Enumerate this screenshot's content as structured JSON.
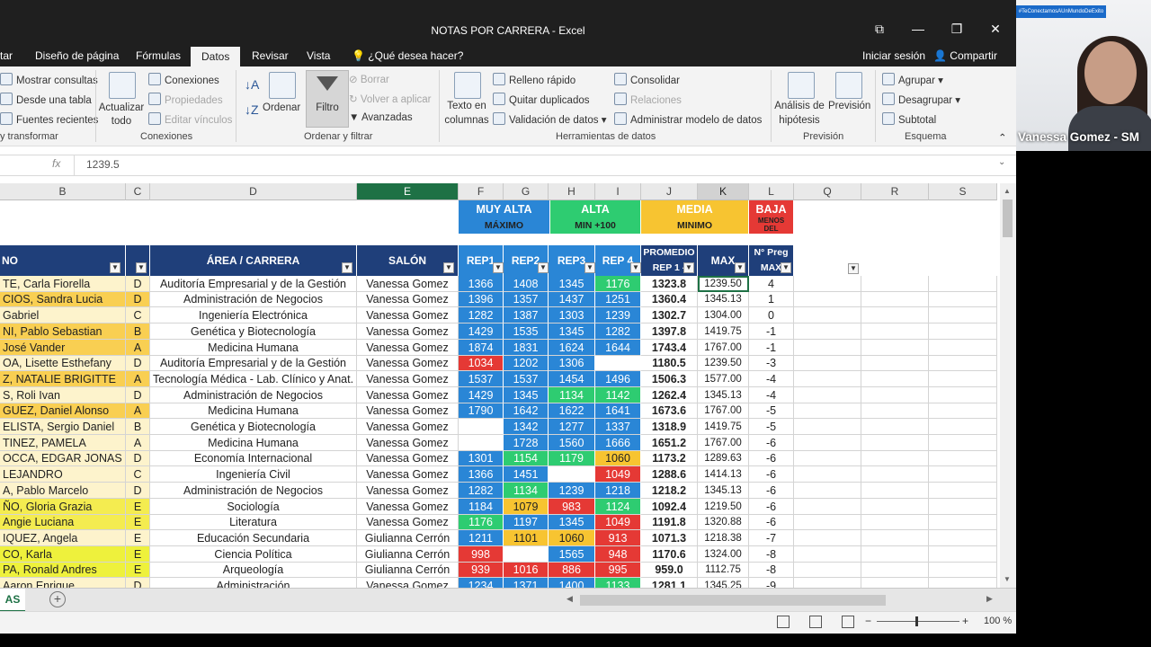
{
  "window": {
    "title": "NOTAS POR CARRERA - Excel"
  },
  "tabs": [
    {
      "label": "tar"
    },
    {
      "label": "Diseño de página"
    },
    {
      "label": "Fórmulas"
    },
    {
      "label": "Datos"
    },
    {
      "label": "Revisar"
    },
    {
      "label": "Vista"
    }
  ],
  "tell_me": "¿Qué desea hacer?",
  "signin": "Iniciar sesión",
  "share": "Compartir",
  "ribbon": {
    "get_transform": {
      "items": [
        "Mostrar consultas",
        "Desde una tabla",
        "Fuentes recientes"
      ],
      "label": "y transformar"
    },
    "connections": {
      "refresh_line1": "Actualizar",
      "refresh_line2": "todo",
      "items": [
        "Conexiones",
        "Propiedades",
        "Editar vínculos"
      ],
      "label": "Conexiones"
    },
    "sort_filter": {
      "sort": "Ordenar",
      "filter": "Filtro",
      "items": [
        "Borrar",
        "Volver a aplicar",
        "Avanzadas"
      ],
      "label": "Ordenar y filtrar"
    },
    "data_tools": {
      "text_cols_line1": "Texto en",
      "text_cols_line2": "columnas",
      "items": [
        "Relleno rápido",
        "Quitar duplicados",
        "Validación de datos",
        "Consolidar",
        "Relaciones",
        "Administrar modelo de datos"
      ],
      "label": "Herramientas de datos"
    },
    "forecast": {
      "whatif_line1": "Análisis de",
      "whatif_line2": "hipótesis",
      "forecast": "Previsión",
      "label": "Previsión"
    },
    "outline": {
      "items": [
        "Agrupar",
        "Desagrupar",
        "Subtotal"
      ],
      "label": "Esquema"
    }
  },
  "formula_bar": {
    "fx": "fx",
    "value": "1239.5"
  },
  "columns": [
    "B",
    "C",
    "D",
    "E",
    "F",
    "G",
    "H",
    "I",
    "J",
    "K",
    "L",
    "Q",
    "R",
    "S"
  ],
  "category_row": {
    "muy_alta": "MUY ALTA",
    "alta": "ALTA",
    "media": "MEDIA",
    "baja": "BAJA",
    "maximo": "MÁXIMO",
    "min100": "MIN +100",
    "minimo": "MINIMO",
    "menos_line1": "MENOS",
    "menos_line2": "DEL"
  },
  "headers": {
    "name": "NO",
    "area": "ÁREA / CARRERA",
    "salon": "SALÓN",
    "rep1": "REP1",
    "rep2": "REP2",
    "rep3": "REP3",
    "rep4": "REP 4",
    "prom_line1": "PROMEDIO",
    "prom_line2": "REP 1 -",
    "max": "MAX",
    "npreg_line1": "N° Preg",
    "npreg_line2": "MAX"
  },
  "colors": {
    "muy_alta": "#2a86d6",
    "alta": "#2ecc71",
    "media": "#f7c431",
    "baja": "#e53935",
    "header_blue": "#1f3f7a",
    "excel_green": "#1e7145"
  },
  "rows": [
    {
      "name": "TE, Carla Fiorella",
      "group": "D",
      "area": "Auditoría Empresarial y de la Gestión",
      "salon": "Vanessa Gomez",
      "r1": "1366",
      "r2": "1408",
      "r3": "1345",
      "r4": "1176",
      "prom": "1323.8",
      "max": "1239.50",
      "np": "4"
    },
    {
      "name": "CIOS, Sandra Lucia",
      "group": "D",
      "area": "Administración de Negocios",
      "salon": "Vanessa Gomez",
      "r1": "1396",
      "r2": "1357",
      "r3": "1437",
      "r4": "1251",
      "prom": "1360.4",
      "max": "1345.13",
      "np": "1"
    },
    {
      "name": "Gabriel",
      "group": "C",
      "area": "Ingeniería Electrónica",
      "salon": "Vanessa Gomez",
      "r1": "1282",
      "r2": "1387",
      "r3": "1303",
      "r4": "1239",
      "prom": "1302.7",
      "max": "1304.00",
      "np": "0"
    },
    {
      "name": "NI, Pablo Sebastian",
      "group": "B",
      "area": "Genética y Biotecnología",
      "salon": "Vanessa Gomez",
      "r1": "1429",
      "r2": "1535",
      "r3": "1345",
      "r4": "1282",
      "prom": "1397.8",
      "max": "1419.75",
      "np": "-1"
    },
    {
      "name": "José Vander",
      "group": "A",
      "area": "Medicina Humana",
      "salon": "Vanessa Gomez",
      "r1": "1874",
      "r2": "1831",
      "r3": "1624",
      "r4": "1644",
      "prom": "1743.4",
      "max": "1767.00",
      "np": "-1"
    },
    {
      "name": "OA, Lisette Esthefany",
      "group": "D",
      "area": "Auditoría Empresarial y de la Gestión",
      "salon": "Vanessa Gomez",
      "r1": "1034",
      "r2": "1202",
      "r3": "1306",
      "r4": "",
      "prom": "1180.5",
      "max": "1239.50",
      "np": "-3"
    },
    {
      "name": "Z, NATALIE BRIGITTE",
      "group": "A",
      "area": "Tecnología Médica - Lab. Clínico y Anat.",
      "salon": "Vanessa Gomez",
      "r1": "1537",
      "r2": "1537",
      "r3": "1454",
      "r4": "1496",
      "prom": "1506.3",
      "max": "1577.00",
      "np": "-4"
    },
    {
      "name": "S, Roli Ivan",
      "group": "D",
      "area": "Administración de Negocios",
      "salon": "Vanessa Gomez",
      "r1": "1429",
      "r2": "1345",
      "r3": "1134",
      "r4": "1142",
      "prom": "1262.4",
      "max": "1345.13",
      "np": "-4"
    },
    {
      "name": "GUEZ, Daniel Alonso",
      "group": "A",
      "area": "Medicina Humana",
      "salon": "Vanessa Gomez",
      "r1": "1790",
      "r2": "1642",
      "r3": "1622",
      "r4": "1641",
      "prom": "1673.6",
      "max": "1767.00",
      "np": "-5"
    },
    {
      "name": "ELISTA, Sergio Daniel",
      "group": "B",
      "area": "Genética y Biotecnología",
      "salon": "Vanessa Gomez",
      "r1": "",
      "r2": "1342",
      "r3": "1277",
      "r4": "1337",
      "prom": "1318.9",
      "max": "1419.75",
      "np": "-5"
    },
    {
      "name": "TINEZ, PAMELA",
      "group": "A",
      "area": "Medicina Humana",
      "salon": "Vanessa Gomez",
      "r1": "",
      "r2": "1728",
      "r3": "1560",
      "r4": "1666",
      "prom": "1651.2",
      "max": "1767.00",
      "np": "-6"
    },
    {
      "name": "OCCA, EDGAR JONAS",
      "group": "D",
      "area": "Economía Internacional",
      "salon": "Vanessa Gomez",
      "r1": "1301",
      "r2": "1154",
      "r3": "1179",
      "r4": "1060",
      "prom": "1173.2",
      "max": "1289.63",
      "np": "-6"
    },
    {
      "name": "LEJANDRO",
      "group": "C",
      "area": "Ingeniería Civil",
      "salon": "Vanessa Gomez",
      "r1": "1366",
      "r2": "1451",
      "r3": "",
      "r4": "1049",
      "prom": "1288.6",
      "max": "1414.13",
      "np": "-6"
    },
    {
      "name": "A, Pablo Marcelo",
      "group": "D",
      "area": "Administración de Negocios",
      "salon": "Vanessa Gomez",
      "r1": "1282",
      "r2": "1134",
      "r3": "1239",
      "r4": "1218",
      "prom": "1218.2",
      "max": "1345.13",
      "np": "-6"
    },
    {
      "name": "ÑO, Gloria Grazia",
      "group": "E",
      "area": "Sociología",
      "salon": "Vanessa Gomez",
      "r1": "1184",
      "r2": "1079",
      "r3": "983",
      "r4": "1124",
      "prom": "1092.4",
      "max": "1219.50",
      "np": "-6"
    },
    {
      "name": "Angie Luciana",
      "group": "E",
      "area": "Literatura",
      "salon": "Vanessa Gomez",
      "r1": "1176",
      "r2": "1197",
      "r3": "1345",
      "r4": "1049",
      "prom": "1191.8",
      "max": "1320.88",
      "np": "-6"
    },
    {
      "name": "IQUEZ, Angela",
      "group": "E",
      "area": "Educación Secundaria",
      "salon": "Giulianna Cerrón",
      "r1": "1211",
      "r2": "1101",
      "r3": "1060",
      "r4": "913",
      "prom": "1071.3",
      "max": "1218.38",
      "np": "-7"
    },
    {
      "name": "CO, Karla",
      "group": "E",
      "area": "Ciencia Política",
      "salon": "Giulianna Cerrón",
      "r1": "998",
      "r2": "",
      "r3": "1565",
      "r4": "948",
      "prom": "1170.6",
      "max": "1324.00",
      "np": "-8"
    },
    {
      "name": "PA, Ronald Andres",
      "group": "E",
      "area": "Arqueología",
      "salon": "Giulianna Cerrón",
      "r1": "939",
      "r2": "1016",
      "r3": "886",
      "r4": "995",
      "prom": "959.0",
      "max": "1112.75",
      "np": "-8"
    },
    {
      "name": "Aaron Enrique",
      "group": "D",
      "area": "Administración",
      "salon": "Vanessa Gomez",
      "r1": "1234",
      "r2": "1371",
      "r3": "1400",
      "r4": "1133",
      "prom": "1281.1",
      "max": "1345.25",
      "np": "-9"
    }
  ],
  "sheet_tab": "AS",
  "zoom": "100 %",
  "webcam": {
    "hashtag": "#TeConectamosAUnMundoDeExito",
    "name": "Vanessa Gomez - SM"
  }
}
